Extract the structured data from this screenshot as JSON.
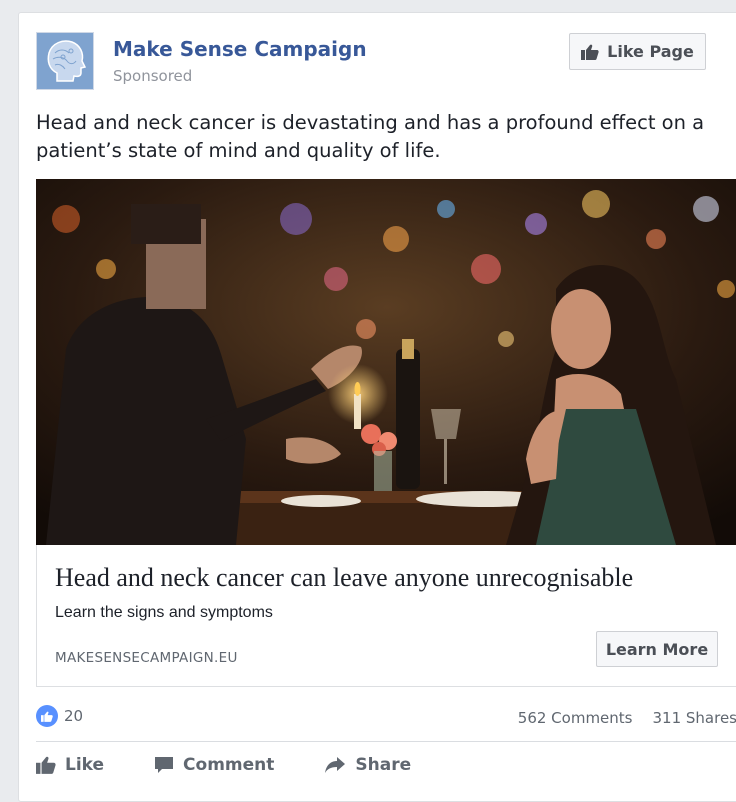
{
  "header": {
    "page_name": "Make Sense Campaign",
    "sponsored_label": "Sponsored",
    "like_page_label": "Like Page",
    "avatar_icon": "head-profile-icon"
  },
  "post": {
    "text": "Head and neck cancer is devastating and has a profound effect on a patient’s state of mind and quality of life."
  },
  "image": {
    "description_icon": "photo-couple-dining"
  },
  "link": {
    "headline": "Head and neck cancer can leave anyone unrecognisable",
    "description": "Learn the signs and symptoms",
    "domain": "MAKESENSECAMPAIGN.EU",
    "cta_label": "Learn More"
  },
  "stats": {
    "reaction_count": "20",
    "comments": "562 Comments",
    "shares": "311 Shares"
  },
  "actions": {
    "like": "Like",
    "comment": "Comment",
    "share": "Share"
  },
  "colors": {
    "brand_blue": "#385898",
    "like_blue": "#5890ff",
    "muted": "#90949c"
  }
}
